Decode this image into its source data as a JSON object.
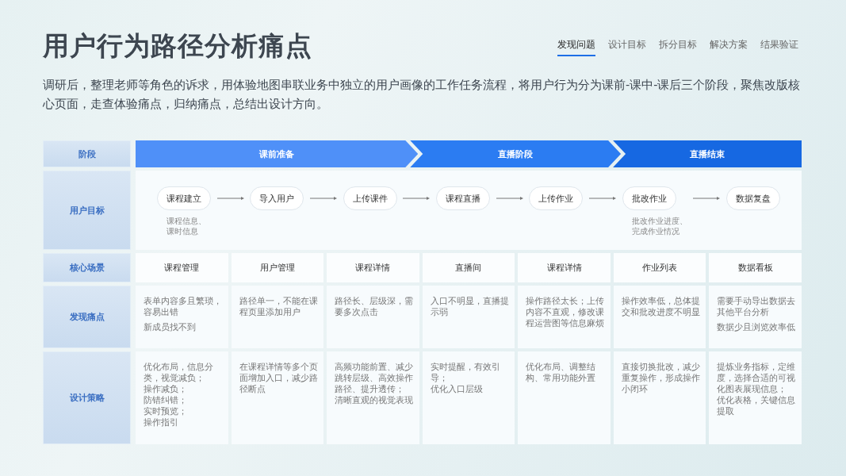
{
  "title": "用户行为路径分析痛点",
  "tabs": [
    {
      "label": "发现问题",
      "selected": true
    },
    {
      "label": "设计目标",
      "selected": false
    },
    {
      "label": "拆分目标",
      "selected": false
    },
    {
      "label": "解决方案",
      "selected": false
    },
    {
      "label": "结果验证",
      "selected": false
    }
  ],
  "intro": "调研后，整理老师等角色的诉求，用体验地图串联业务中独立的用户画像的工作任务流程，将用户行为分为课前-课中-课后三个阶段，聚焦改版核心页面，走查体验痛点，归纳痛点，总结出设计方向。",
  "row_labels": [
    "阶段",
    "用户目标",
    "核心场景",
    "发现痛点",
    "设计策略"
  ],
  "stages": [
    {
      "label": "课前准备",
      "color": "#4f90f8"
    },
    {
      "label": "直播阶段",
      "color": "#2b7cf2"
    },
    {
      "label": "直播结束",
      "color": "#1668e2"
    }
  ],
  "goals": [
    {
      "label": "课程建立",
      "note": [
        "课程信息、",
        "课时信息"
      ]
    },
    {
      "label": "导入用户"
    },
    {
      "label": "上传课件"
    },
    {
      "label": "课程直播"
    },
    {
      "label": "上传作业"
    },
    {
      "label": "批改作业",
      "note": [
        "批改作业进度、",
        "完成作业情况"
      ]
    },
    {
      "label": "数据复盘"
    }
  ],
  "columns": [
    {
      "scene": "课程管理",
      "pain": [
        "表单内容多且繁琐，容易出错",
        "新成员找不到"
      ],
      "strategy": [
        "优化布局，信息分类，视觉减负；",
        "操作减负；",
        "防错纠错；",
        "实时预览；",
        "操作指引"
      ]
    },
    {
      "scene": "用户管理",
      "pain": [
        "路径单一，不能在课程页里添加用户"
      ],
      "strategy": [
        "在课程详情等多个页面增加入口，减少路径断点"
      ]
    },
    {
      "scene": "课程详情",
      "pain": [
        "路径长、层级深，需要多次点击"
      ],
      "strategy": [
        "高频功能前置、减少跳转层级、高效操作路径、提升透传；",
        "清晰直观的视觉表现"
      ]
    },
    {
      "scene": "直播间",
      "pain": [
        "入口不明显，直播提示弱"
      ],
      "strategy": [
        "实时提醒，有效引导；",
        "优化入口层级"
      ]
    },
    {
      "scene": "课程详情",
      "pain": [
        "操作路径太长；上传内容不直观，修改课程运营图等信息麻烦"
      ],
      "strategy": [
        "优化布局、调整结构、常用功能外置"
      ]
    },
    {
      "scene": "作业列表",
      "pain": [
        "操作效率低，总体提交和批改进度不明显"
      ],
      "strategy": [
        "直接切换批改，减少重复操作，形成操作小闭环"
      ]
    },
    {
      "scene": "数据看板",
      "pain": [
        "需要手动导出数据去其他平台分析",
        "数据少且浏览效率低"
      ],
      "strategy": [
        "提炼业务指标，定维度，选择合适的可视化图表展现信息；",
        "优化表格，关键信息提取"
      ]
    }
  ]
}
